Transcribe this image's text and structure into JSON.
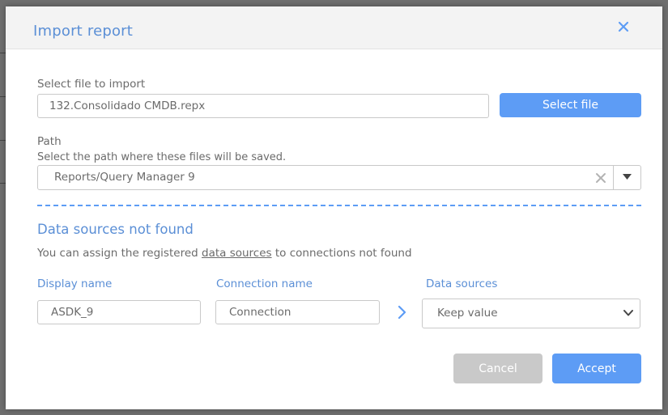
{
  "dialog": {
    "title": "Import report",
    "close_icon": "close-icon"
  },
  "file": {
    "label": "Select file to import",
    "value": "132.Consolidado CMDB.repx",
    "button_label": "Select file"
  },
  "path": {
    "label": "Path",
    "description": "Select the path where these files will be saved.",
    "value": "Reports/Query Manager 9",
    "clear_icon": "clear-icon",
    "toggle_icon": "caret-down-icon"
  },
  "data_sources": {
    "title": "Data sources not found",
    "description_before": "You can assign the registered ",
    "description_link": "data sources",
    "description_after": " to connections not found",
    "columns": {
      "display_name": "Display name",
      "connection_name": "Connection name",
      "data_sources": "Data sources"
    },
    "row": {
      "display_name_value": "ASDK_9",
      "connection_name_value": "Connection",
      "data_source_selected": "Keep value"
    }
  },
  "footer": {
    "cancel_label": "Cancel",
    "accept_label": "Accept"
  },
  "colors": {
    "accent": "#5d9cf5",
    "title": "#5b8fd6",
    "disabled": "#c9c9c9"
  }
}
